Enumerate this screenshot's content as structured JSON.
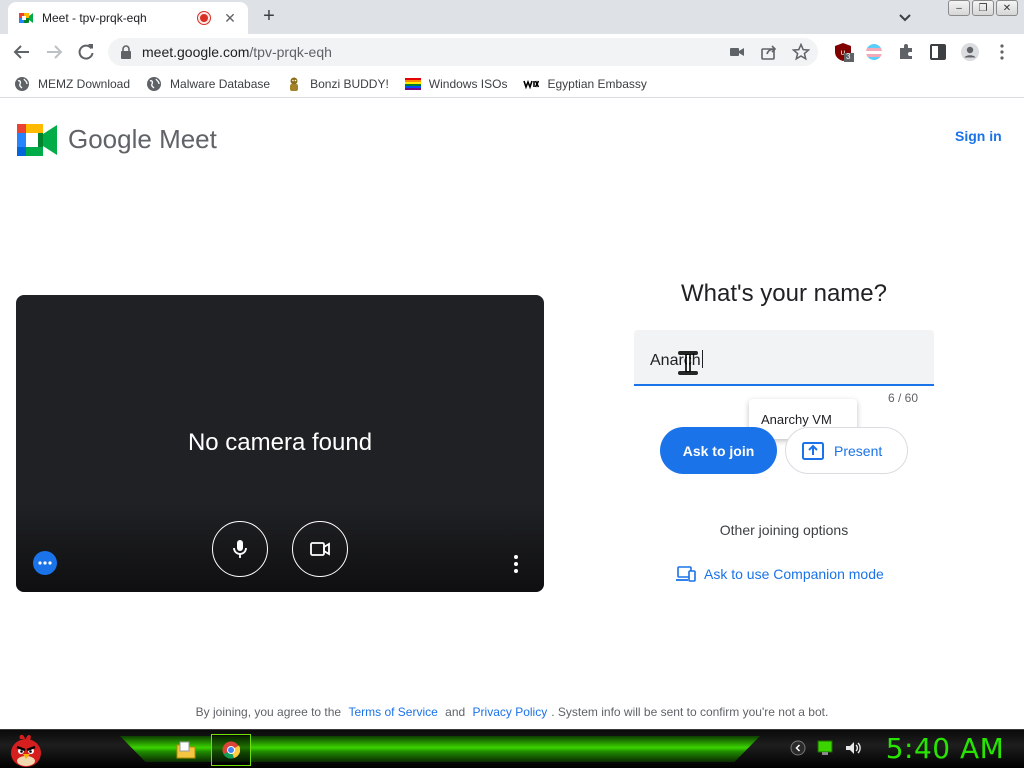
{
  "browser": {
    "tab_title": "Meet - tpv-prqk-eqh",
    "tab_close": "✕",
    "new_tab": "+",
    "url_host": "meet.google.com",
    "url_path": "/tpv-prqk-eqh",
    "extension_badge": "3",
    "window_buttons": [
      "–",
      "❐",
      "✕"
    ],
    "bookmarks": [
      {
        "label": "MEMZ Download",
        "icon": "globe-icon"
      },
      {
        "label": "Malware Database",
        "icon": "globe-icon"
      },
      {
        "label": "Bonzi BUDDY!",
        "icon": "bonzi-icon"
      },
      {
        "label": "Windows ISOs",
        "icon": "rainbow-flag-icon"
      },
      {
        "label": "Egyptian Embassy",
        "icon": "wix-icon"
      }
    ]
  },
  "header": {
    "wordmark": "Google Meet",
    "sign_in": "Sign in"
  },
  "preview": {
    "message": "No camera found"
  },
  "join": {
    "question": "What's your name?",
    "name_value": "Anarch",
    "counter": "6 / 60",
    "autofill_suggestion": "Anarchy VM",
    "ask_to_join": "Ask to join",
    "present": "Present",
    "other_options": "Other joining options",
    "companion_mode": "Ask to use Companion mode"
  },
  "footer": {
    "prefix": "By joining, you agree to the",
    "terms": "Terms of Service",
    "and": "and",
    "privacy": "Privacy Policy",
    "suffix": ". System info will be sent to confirm you're not a bot."
  },
  "taskbar": {
    "clock": "5:40 AM"
  },
  "colors": {
    "accent": "#1a73e8",
    "preview_bg": "#202124",
    "clock_green": "#27e500"
  }
}
